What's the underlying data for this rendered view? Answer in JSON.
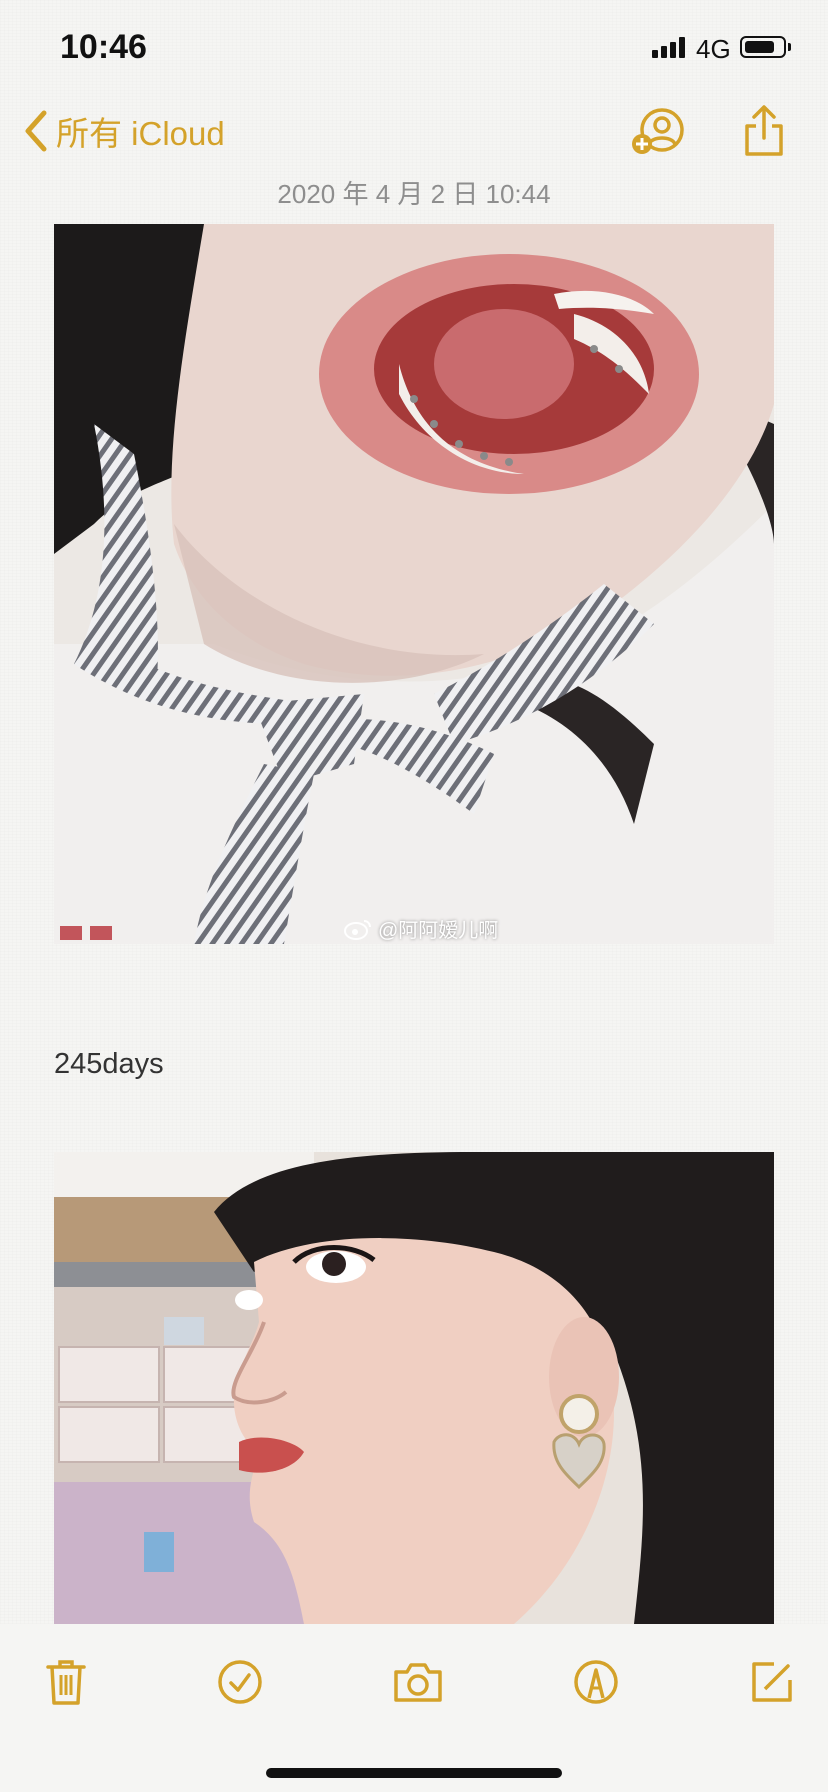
{
  "status_bar": {
    "time": "10:46",
    "network": "4G",
    "signal_bars": 4,
    "battery_level": 0.8
  },
  "nav": {
    "back_label": "所有 iCloud",
    "icons": [
      "add-person-icon",
      "share-icon"
    ]
  },
  "note": {
    "date": "2020 年 4 月 2 日 10:44",
    "text": "245days",
    "watermark": "@阿阿嫒儿啊"
  },
  "toolbar": {
    "icons": [
      "trash-icon",
      "checklist-icon",
      "camera-icon",
      "markup-icon",
      "compose-icon"
    ]
  },
  "colors": {
    "accent": "#d4a22a",
    "background": "#f5f5f3",
    "date_text": "#8e8e8e"
  }
}
